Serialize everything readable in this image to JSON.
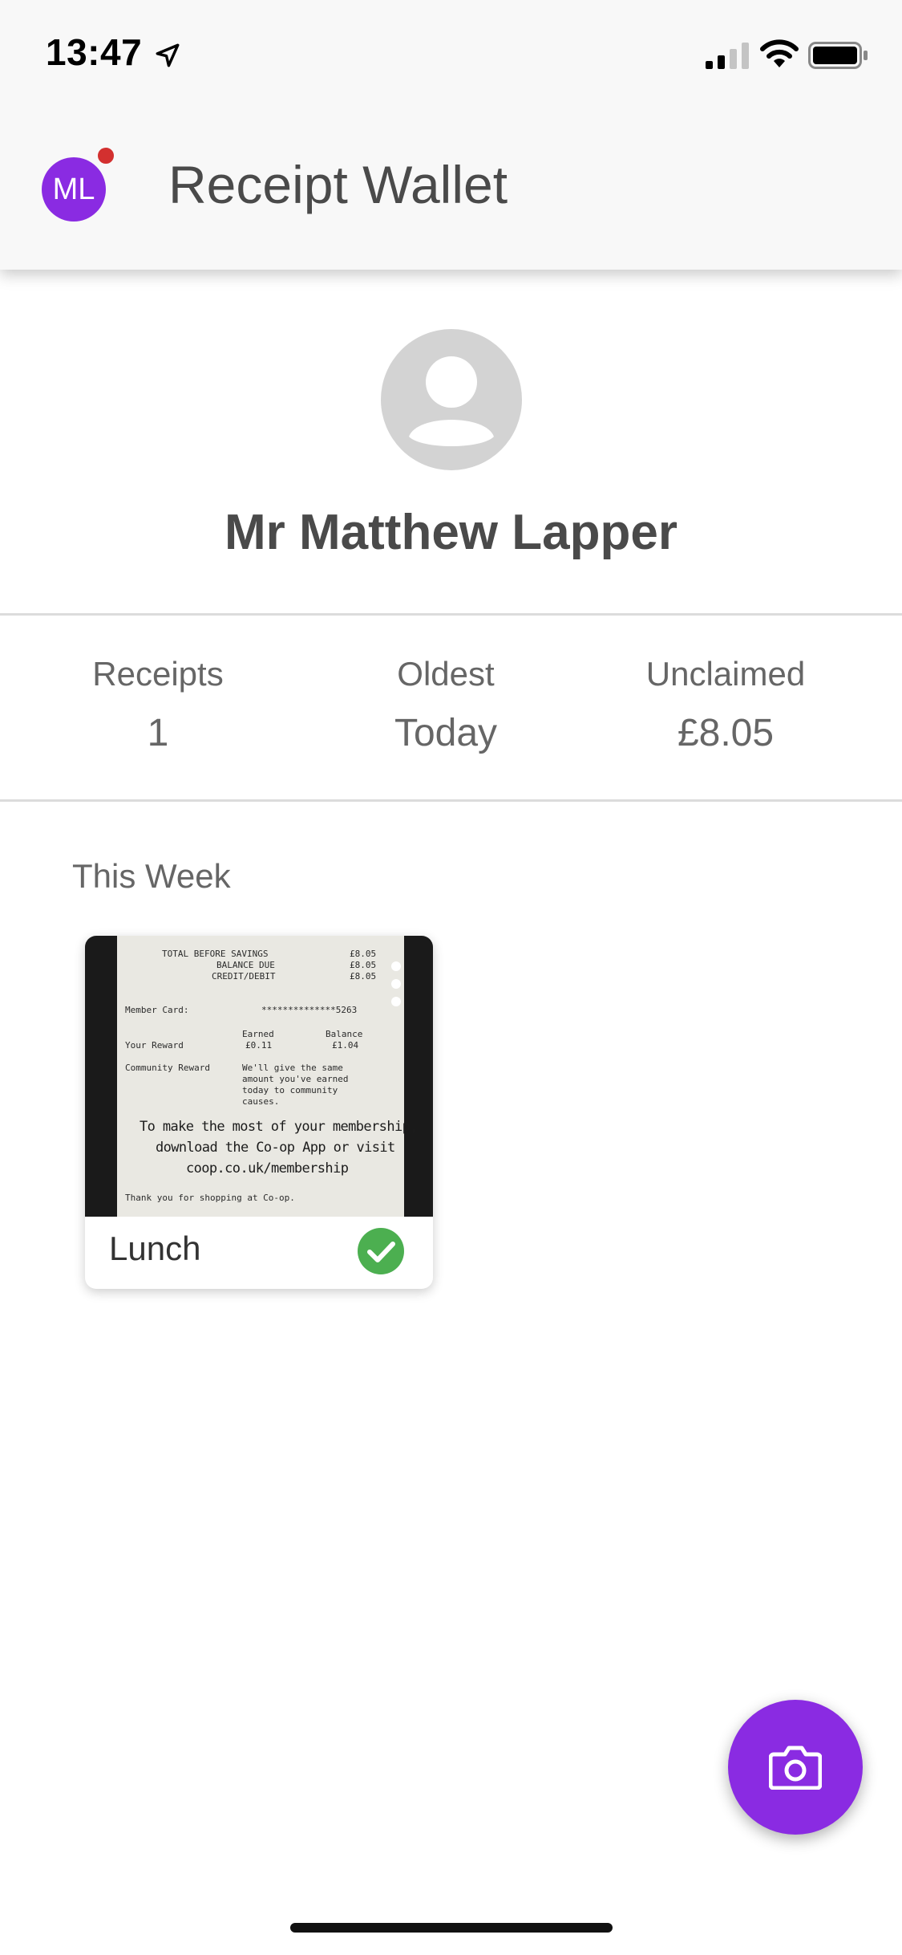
{
  "status_bar": {
    "time": "13:47",
    "location_icon": "location-arrow-icon",
    "signal_icon": "cellular-signal-icon",
    "wifi_icon": "wifi-icon",
    "battery_icon": "battery-icon"
  },
  "app_bar": {
    "avatar_initials": "ML",
    "notification_icon": "notification-dot",
    "title": "Receipt Wallet"
  },
  "profile": {
    "avatar_icon": "person-placeholder-icon",
    "name": "Mr Matthew Lapper"
  },
  "stats": [
    {
      "label": "Receipts",
      "value": "1"
    },
    {
      "label": "Oldest",
      "value": "Today"
    },
    {
      "label": "Unclaimed",
      "value": "£8.05"
    }
  ],
  "section": {
    "label": "This Week"
  },
  "receipts": [
    {
      "label": "Lunch",
      "status_icon": "check-circle-icon",
      "image_text": {
        "line1": "TOTAL BEFORE SAVINGS",
        "line1_amt": "£8.05",
        "line2": "BALANCE DUE",
        "line2_amt": "£8.05",
        "line3": "CREDIT/DEBIT",
        "line3_amt": "£8.05",
        "member_card": "Member Card:",
        "card_number": "**************5263",
        "earned": "Earned",
        "balance": "Balance",
        "your_reward": "Your Reward",
        "reward_earned": "£0.11",
        "reward_balance": "£1.04",
        "community": "Community Reward",
        "community_1": "We'll give the same",
        "community_2": "amount you've earned",
        "community_3": "today to community",
        "community_4": "causes.",
        "promo_1": "To make the most of your membership,",
        "promo_2": "download the Co-op App or visit",
        "promo_3": "coop.co.uk/membership",
        "thanks": "Thank you for shopping at Co-op."
      }
    }
  ],
  "fab": {
    "icon": "camera-icon"
  },
  "colors": {
    "accent": "#8a2be2",
    "notification": "#d3302f",
    "success": "#4caf50"
  }
}
